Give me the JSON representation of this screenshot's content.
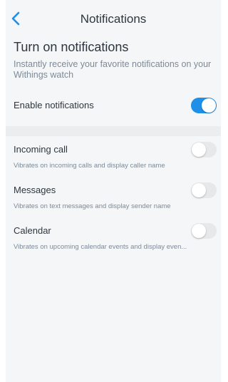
{
  "header": {
    "title": "Notifications",
    "back_icon": "chevron-left-icon"
  },
  "intro": {
    "heading": "Turn on notifications",
    "description": "Instantly receive your favorite notifications on your Withings watch"
  },
  "master": {
    "label": "Enable notifications",
    "enabled": true
  },
  "settings": [
    {
      "label": "Incoming call",
      "description": "Vibrates on incoming calls and display caller name",
      "enabled": false
    },
    {
      "label": "Messages",
      "description": "Vibrates on text messages and display sender name",
      "enabled": false
    },
    {
      "label": "Calendar",
      "description": "Vibrates on upcoming calendar events and display even...",
      "enabled": false
    }
  ],
  "colors": {
    "accent": "#1f8fe8",
    "background": "#f5f6f7",
    "muted_text": "#7d8a98"
  }
}
